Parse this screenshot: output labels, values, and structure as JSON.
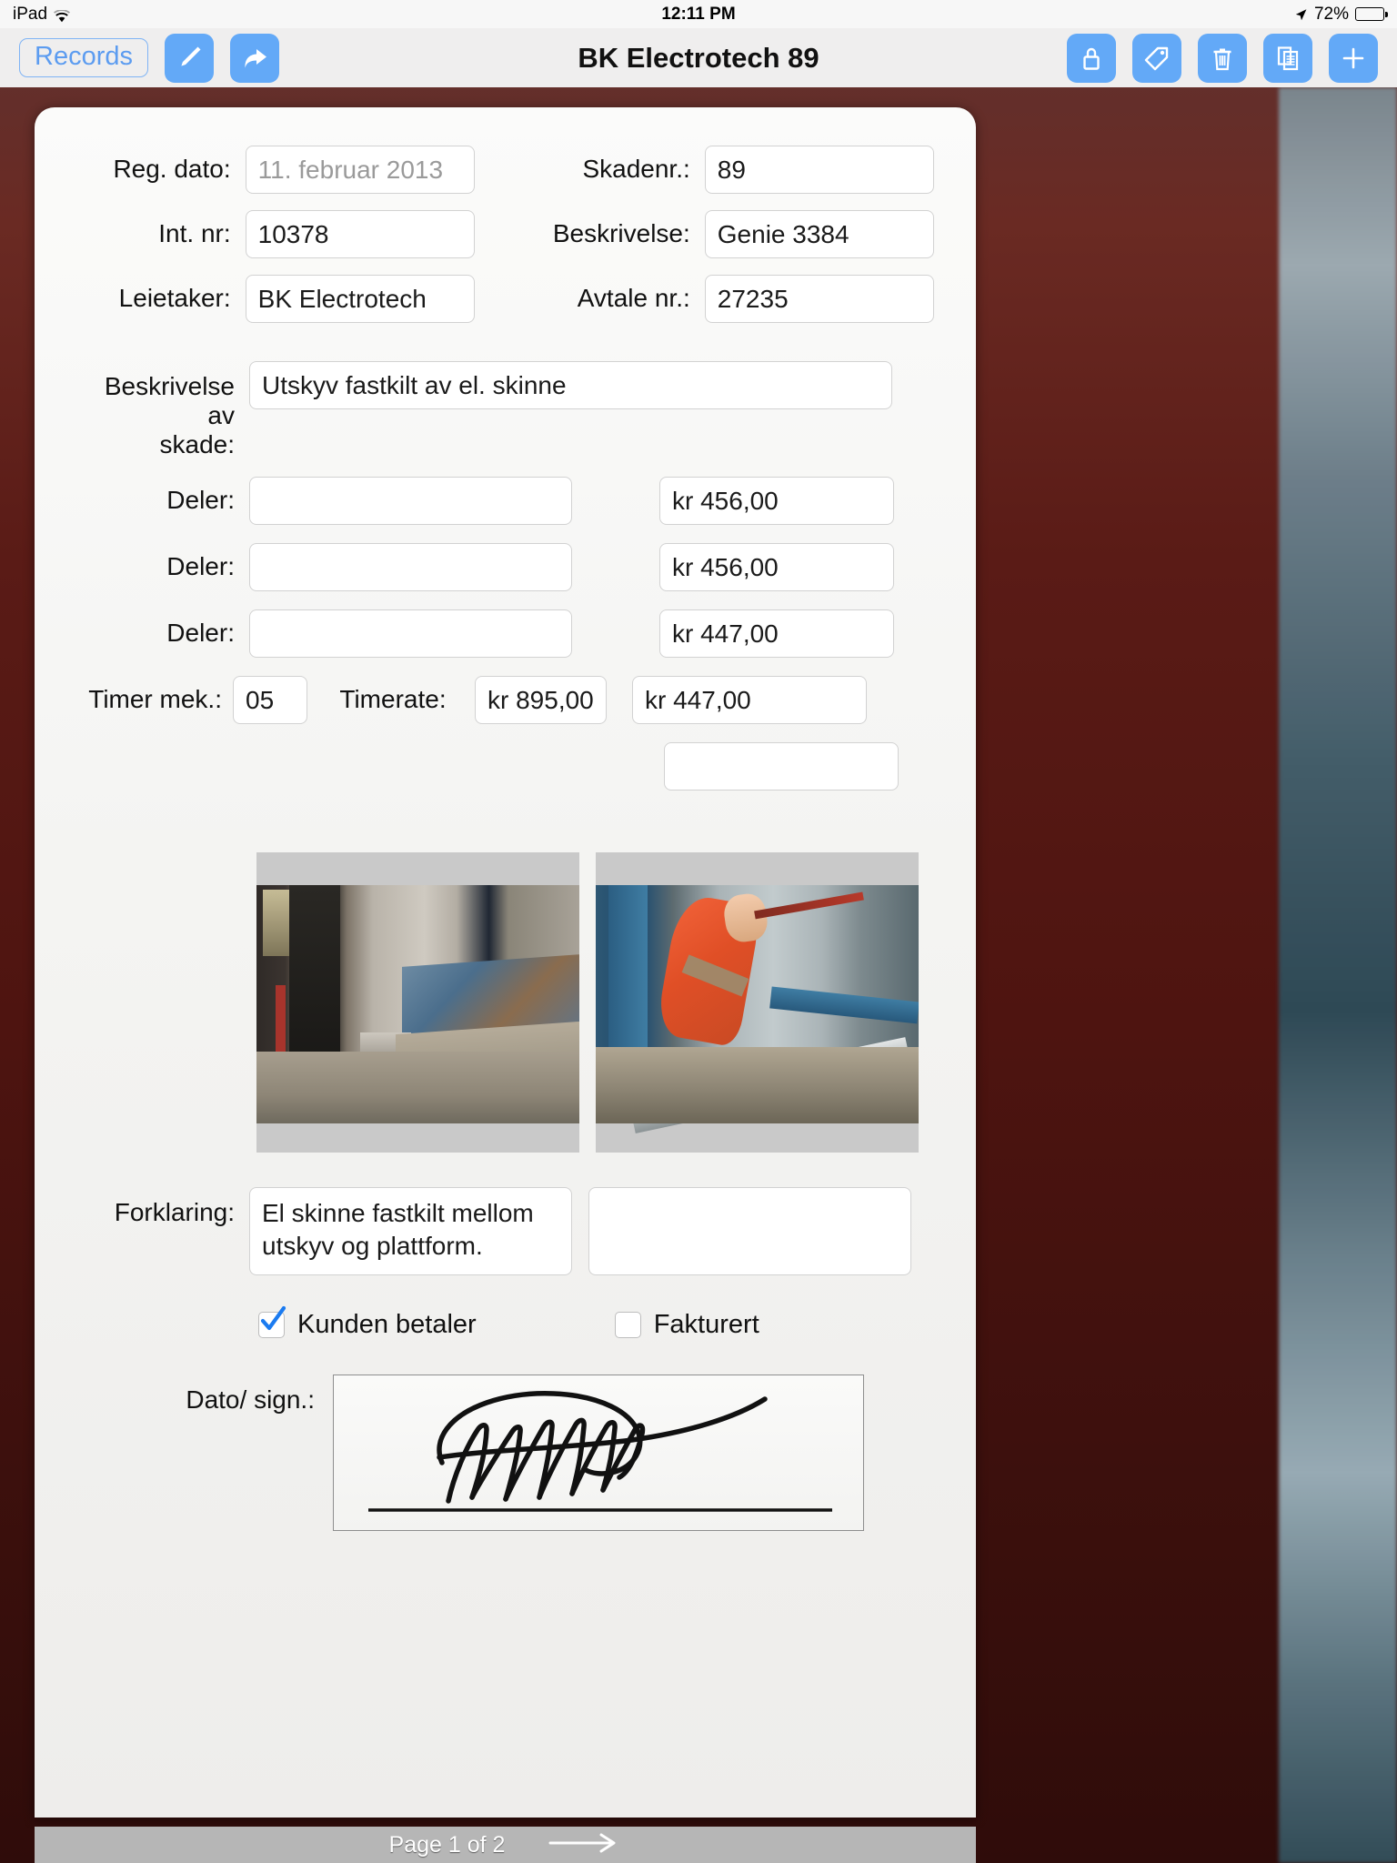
{
  "status_bar": {
    "device": "iPad",
    "wifi_icon": "wifi-icon",
    "time": "12:11 PM",
    "location_icon": "location-arrow-icon",
    "battery_percent": "72%",
    "battery_icon": "battery-icon"
  },
  "nav_bar": {
    "back_label": "Records",
    "title": "BK Electrotech 89",
    "left_tools": [
      {
        "name": "pen-tool-button",
        "icon": "pen-icon"
      },
      {
        "name": "share-button",
        "icon": "share-arrow-icon"
      }
    ],
    "right_tools": [
      {
        "name": "lock-button",
        "icon": "lock-icon"
      },
      {
        "name": "tag-button",
        "icon": "tag-icon"
      },
      {
        "name": "delete-button",
        "icon": "trash-icon"
      },
      {
        "name": "duplicate-button",
        "icon": "documents-icon"
      },
      {
        "name": "add-button",
        "icon": "plus-icon"
      }
    ]
  },
  "form": {
    "reg_dato": {
      "label": "Reg. dato:",
      "value": "11. februar 2013",
      "is_placeholder": true
    },
    "skadenr": {
      "label": "Skadenr.:",
      "value": "89"
    },
    "int_nr": {
      "label": "Int. nr:",
      "value": "10378"
    },
    "beskrivelse": {
      "label": "Beskrivelse:",
      "value": "Genie 3384"
    },
    "leietaker": {
      "label": "Leietaker:",
      "value": "BK Electrotech"
    },
    "avtale_nr": {
      "label": "Avtale nr.:",
      "value": "27235"
    },
    "beskrivelse_av_skade": {
      "label": "Beskrivelse av\nskade:",
      "value": "Utskyv fastkilt av el. skinne"
    },
    "deler_rows": [
      {
        "label": "Deler:",
        "description": "",
        "amount": "kr 456,00"
      },
      {
        "label": "Deler:",
        "description": "",
        "amount": "kr 456,00"
      },
      {
        "label": "Deler:",
        "description": "",
        "amount": "kr 447,00"
      }
    ],
    "timer": {
      "hours_label": "Timer mek.:",
      "hours_value": "05",
      "rate_label": "Timerate:",
      "rate_value": "kr 895,00",
      "amount": "kr 447,00"
    },
    "total_row": {
      "amount": ""
    },
    "photos": [
      {
        "name": "damage-photo-1"
      },
      {
        "name": "damage-photo-2"
      }
    ],
    "forklaring": {
      "label": "Forklaring:",
      "value": "El skinne fastkilt mellom utskyv og plattform.",
      "second_value": ""
    },
    "checkboxes": [
      {
        "label": "Kunden betaler",
        "checked": true,
        "name": "checkbox-kunden-betaler"
      },
      {
        "label": "Fakturert",
        "checked": false,
        "name": "checkbox-fakturert"
      }
    ],
    "signature": {
      "label": "Dato/ sign.:",
      "has_signature": true
    }
  },
  "footer": {
    "page_text": "Page 1 of 2",
    "next_icon": "arrow-right-icon"
  },
  "colors": {
    "accent_blue": "#63a9f7",
    "link_blue": "#5c9cf0",
    "paper": "#f6f5f3",
    "backdrop": "#5d1411"
  }
}
